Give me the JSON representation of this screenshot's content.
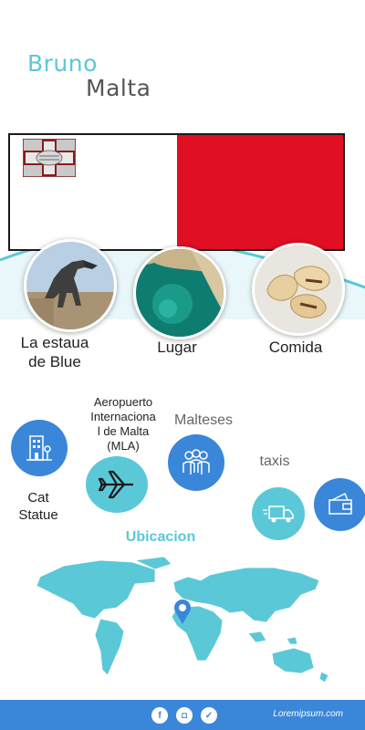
{
  "header": {
    "name": "Bruno",
    "country": "Malta"
  },
  "flag": {
    "left_color": "#ffffff",
    "right_color": "#e00f23"
  },
  "photos": [
    {
      "label_line1": "La estaua",
      "label_line2": "de  Blue",
      "icon": "dinosaur-statue-photo"
    },
    {
      "label": "Lugar",
      "icon": "coastal-bay-photo"
    },
    {
      "label": "Comida",
      "icon": "pastizzi-food-photo"
    }
  ],
  "info": {
    "cat_statue_line1": "Cat",
    "cat_statue_line2": "Statue",
    "airport_lines": [
      "Aeropuerto",
      "Internaciona",
      "l de Malta",
      "(MLA)"
    ],
    "malteses": "Malteses",
    "taxis": "taxis",
    "section_title": "Ubicacion"
  },
  "colors": {
    "accent": "#5bc8d8",
    "footer": "#3a86d8",
    "icon_blue": "#3a86d8"
  },
  "footer": {
    "site": "Loremipsum.com",
    "social": [
      "facebook-icon",
      "instagram-icon",
      "twitter-icon"
    ]
  }
}
